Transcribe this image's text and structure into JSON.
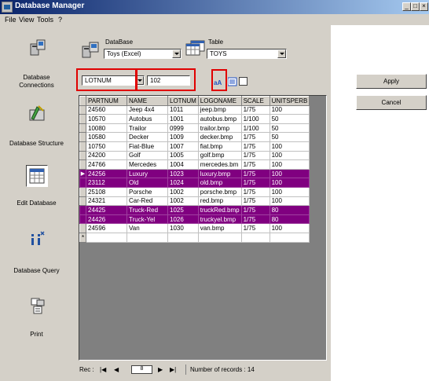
{
  "window": {
    "title": "Database Manager",
    "controls": [
      "_",
      "□",
      "×"
    ]
  },
  "menu": [
    "File",
    "View",
    "Tools",
    "?"
  ],
  "nav": [
    {
      "label": "Database Connections",
      "icon": "database-connections-icon"
    },
    {
      "label": "Database Structure",
      "icon": "database-structure-icon"
    },
    {
      "label": "Edit Database",
      "icon": "edit-database-icon"
    },
    {
      "label": "Database Query",
      "icon": "database-query-icon"
    },
    {
      "label": "Print",
      "icon": "print-icon"
    }
  ],
  "database": {
    "label": "DataBase",
    "value": "Toys (Excel)"
  },
  "table": {
    "label": "Table",
    "value": "TOYS"
  },
  "filter": {
    "field": "LOTNUM",
    "value": "102"
  },
  "buttons": {
    "apply": "Apply",
    "cancel": "Cancel"
  },
  "grid": {
    "columns": [
      "PARTNUM",
      "NAME",
      "LOTNUM",
      "LOGONAME",
      "SCALE",
      "UNITSPERB"
    ],
    "rows": [
      [
        "24560",
        "Jeep 4x4",
        "1011",
        "jeep.bmp",
        "1/75",
        "100"
      ],
      [
        "10570",
        "Autobus",
        "1001",
        "autobus.bmp",
        "1/100",
        "50"
      ],
      [
        "10080",
        "Trailor",
        "0999",
        "trailor.bmp",
        "1/100",
        "50"
      ],
      [
        "10580",
        "Decker",
        "1009",
        "decker.bmp",
        "1/75",
        "50"
      ],
      [
        "10750",
        "Fiat-Blue",
        "1007",
        "fiat.bmp",
        "1/75",
        "100"
      ],
      [
        "24200",
        "Golf",
        "1005",
        "golf.bmp",
        "1/75",
        "100"
      ],
      [
        "24766",
        "Mercedes",
        "1004",
        "mercedes.bm",
        "1/75",
        "100"
      ],
      [
        "24256",
        "Luxury",
        "1023",
        "luxury.bmp",
        "1/75",
        "100"
      ],
      [
        "23112",
        "Old",
        "1024",
        "old.bmp",
        "1/75",
        "100"
      ],
      [
        "25108",
        "Porsche",
        "1002",
        "porsche.bmp",
        "1/75",
        "100"
      ],
      [
        "24321",
        "Car-Red",
        "1002",
        "red.bmp",
        "1/75",
        "100"
      ],
      [
        "24425",
        "Truck-Red",
        "1025",
        "truckRed.bmp",
        "1/75",
        "80"
      ],
      [
        "24426",
        "Truck-Yel",
        "1026",
        "truckyel.bmp",
        "1/75",
        "80"
      ],
      [
        "24596",
        "Van",
        "1030",
        "van.bmp",
        "1/75",
        "100"
      ]
    ],
    "selected_rows": [
      7,
      8,
      11,
      12
    ],
    "current_row": 7,
    "new_row_marker": "*"
  },
  "record_nav": {
    "label": "Rec :",
    "current": "8",
    "count_text": "Number of records : 14"
  },
  "colors": {
    "selection": "#800080",
    "highlight_box": "#e00000",
    "titlebar": "#0a246a"
  }
}
